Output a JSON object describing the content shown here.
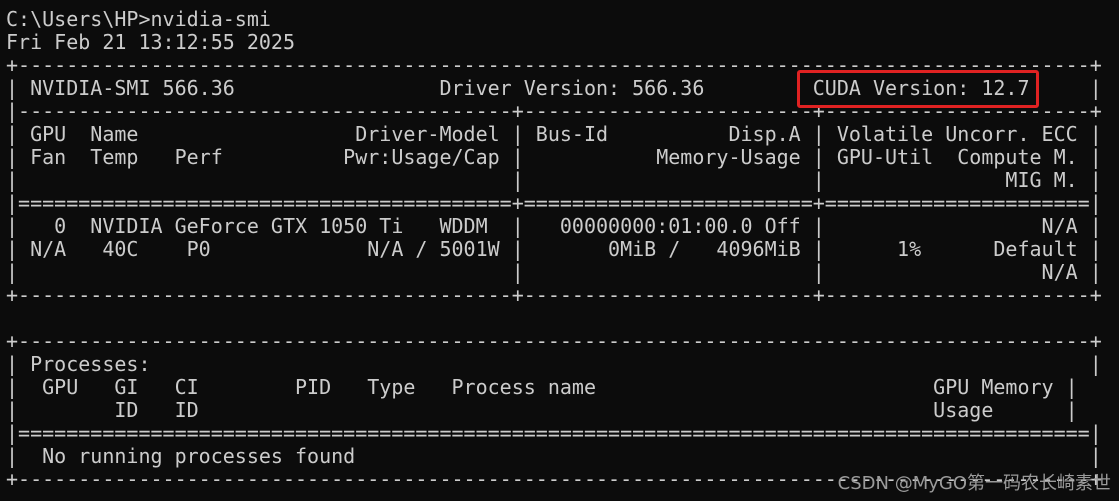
{
  "terminal": {
    "lines": [
      "C:\\Users\\HP>nvidia-smi",
      "Fri Feb 21 13:12:55 2025",
      "+-----------------------------------------------------------------------------------------+",
      "| NVIDIA-SMI 566.36                 Driver Version: 566.36         CUDA Version: 12.7     |",
      "|-----------------------------------------+------------------------+----------------------+",
      "| GPU  Name                  Driver-Model | Bus-Id          Disp.A | Volatile Uncorr. ECC |",
      "| Fan  Temp   Perf          Pwr:Usage/Cap |           Memory-Usage | GPU-Util  Compute M. |",
      "|                                         |                        |               MIG M. |",
      "|=========================================+========================+======================|",
      "|   0  NVIDIA GeForce GTX 1050 Ti   WDDM  |   00000000:01:00.0 Off |                  N/A |",
      "| N/A   40C    P0             N/A / 5001W |       0MiB /   4096MiB |      1%      Default |",
      "|                                         |                        |                  N/A |",
      "+-----------------------------------------+------------------------+----------------------+",
      "",
      "+-----------------------------------------------------------------------------------------+",
      "| Processes:                                                                              |",
      "|  GPU   GI   CI        PID   Type   Process name                            GPU Memory |",
      "|        ID   ID                                                             Usage      |",
      "|=========================================================================================|",
      "|  No running processes found                                                             |",
      "+-----------------------------------------------------------------------------------------+"
    ]
  },
  "highlight": {
    "label": "CUDA Version: 12.7",
    "color": "#e02222"
  },
  "watermark": {
    "text": "CSDN @MyGO第一码农长崎素世"
  },
  "colors": {
    "background": "#0c0c0c",
    "text": "#cccccc"
  }
}
